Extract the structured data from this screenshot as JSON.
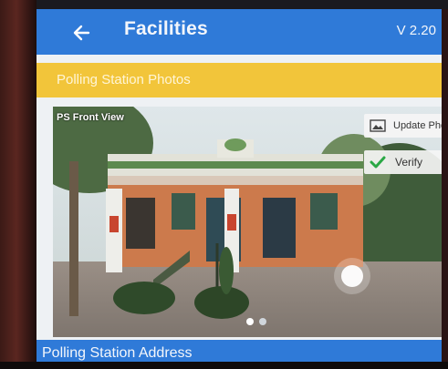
{
  "header": {
    "title": "Facilities",
    "version": "V 2.20",
    "back_icon": "arrow-left-icon"
  },
  "section": {
    "title": "Polling Station Photos"
  },
  "photo": {
    "label": "PS Front View",
    "update_label": "Update Photo",
    "update_icon": "image-icon",
    "verify_label": "Verify",
    "verify_icon": "checkmark-icon",
    "carousel_pages": 2,
    "carousel_current": 1
  },
  "footer": {
    "address_title": "Polling Station Address"
  },
  "colors": {
    "app_bar": "#2f7ad8",
    "section_bar": "#f2c53a",
    "verify_check": "#2aa845"
  }
}
